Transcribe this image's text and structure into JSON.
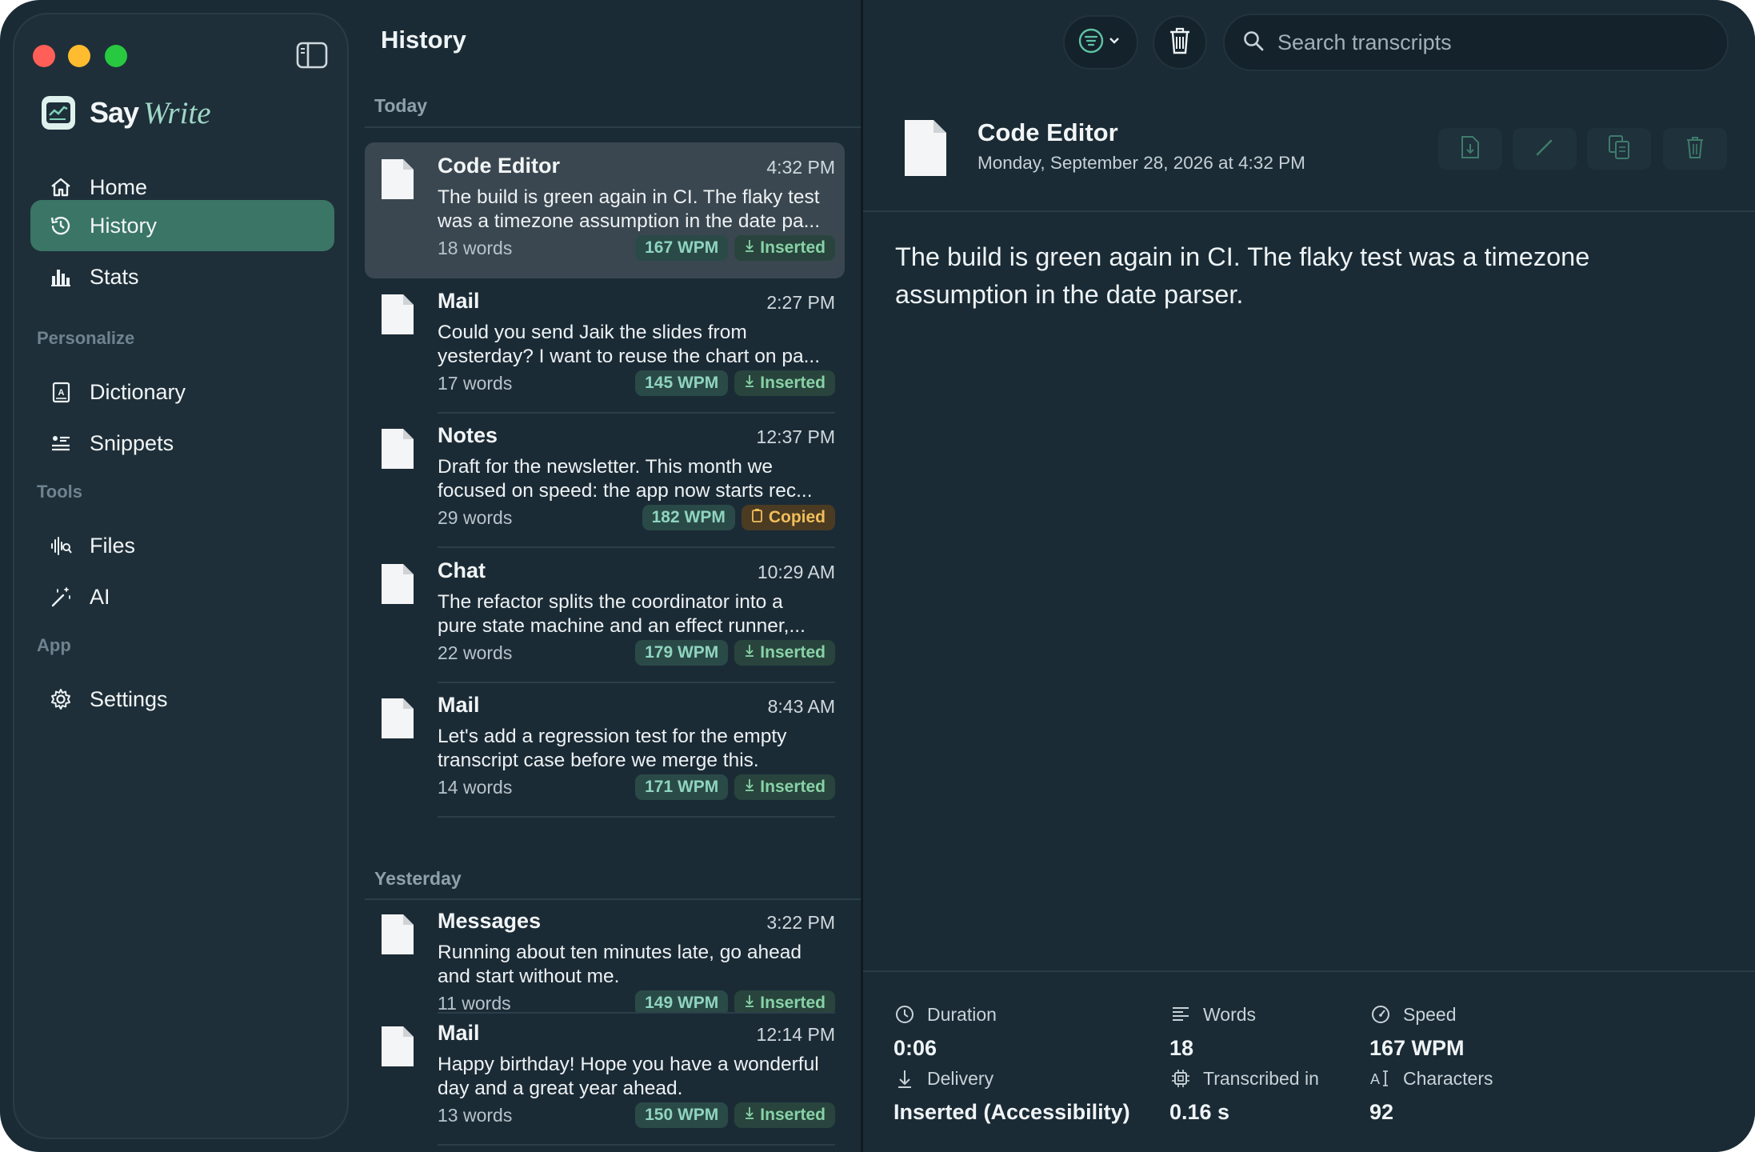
{
  "app": {
    "brand_say": "Say",
    "brand_write": "Write",
    "colors": {
      "accent": "#3a7565",
      "background": "#1b2b36",
      "copied": "#f1be5b",
      "inserted": "#88d2a6"
    }
  },
  "sidebar": {
    "main_items": [
      {
        "label": "Home",
        "icon": "home-icon"
      },
      {
        "label": "History",
        "icon": "history-icon",
        "active": true
      },
      {
        "label": "Stats",
        "icon": "stats-icon"
      }
    ],
    "sections": [
      {
        "title": "Personalize",
        "items": [
          {
            "label": "Dictionary",
            "icon": "dictionary-icon"
          },
          {
            "label": "Snippets",
            "icon": "snippets-icon"
          }
        ]
      },
      {
        "title": "Tools",
        "items": [
          {
            "label": "Files",
            "icon": "waveform-icon"
          },
          {
            "label": "AI",
            "icon": "magic-wand-icon"
          }
        ]
      },
      {
        "title": "App",
        "items": [
          {
            "label": "Settings",
            "icon": "gear-icon"
          }
        ]
      }
    ]
  },
  "history": {
    "title": "History",
    "groups": [
      {
        "label": "Today",
        "items": [
          {
            "app": "Code Editor",
            "time": "4:32 PM",
            "line1": "The build is green again in CI. The flaky test",
            "line2": "was a timezone assumption in the date pa...",
            "words": "18 words",
            "wpm": "167 WPM",
            "status": "Inserted",
            "status_kind": "inserted",
            "selected": true
          },
          {
            "app": "Mail",
            "time": "2:27 PM",
            "line1": "Could you send Jaik the slides from",
            "line2": "yesterday? I want to reuse the chart on pa...",
            "words": "17 words",
            "wpm": "145 WPM",
            "status": "Inserted",
            "status_kind": "inserted"
          },
          {
            "app": "Notes",
            "time": "12:37 PM",
            "line1": "Draft for the newsletter. This month we",
            "line2": "focused on speed: the app now starts rec...",
            "words": "29 words",
            "wpm": "182 WPM",
            "status": "Copied",
            "status_kind": "copied"
          },
          {
            "app": "Chat",
            "time": "10:29 AM",
            "line1": "The refactor splits the coordinator into a",
            "line2": "pure state machine and an effect runner,...",
            "words": "22 words",
            "wpm": "179 WPM",
            "status": "Inserted",
            "status_kind": "inserted"
          },
          {
            "app": "Mail",
            "time": "8:43 AM",
            "line1": "Let's add a regression test for the empty",
            "line2": "transcript case before we merge this.",
            "words": "14 words",
            "wpm": "171 WPM",
            "status": "Inserted",
            "status_kind": "inserted"
          }
        ]
      },
      {
        "label": "Yesterday",
        "items": [
          {
            "app": "Messages",
            "time": "3:22 PM",
            "line1": "Running about ten minutes late, go ahead",
            "line2": "and start without me.",
            "words": "11 words",
            "wpm": "149 WPM",
            "status": "Inserted",
            "status_kind": "inserted"
          },
          {
            "app": "Mail",
            "time": "12:14 PM",
            "line1": "Happy birthday! Hope you have a wonderful",
            "line2": "day and a great year ahead.",
            "words": "13 words",
            "wpm": "150 WPM",
            "status": "Inserted",
            "status_kind": "inserted"
          }
        ]
      }
    ]
  },
  "toolbar": {
    "search_placeholder": "Search transcripts",
    "filter_icon": "filter-icon",
    "delete_all_icon": "trash-icon"
  },
  "detail": {
    "app": "Code Editor",
    "date": "Monday, September 28, 2026 at 4:32 PM",
    "actions": [
      "export-icon",
      "edit-icon",
      "copy-icon",
      "delete-icon"
    ],
    "transcript_line1": "The build is green again in CI. The flaky test was a timezone",
    "transcript_line2": "assumption in the date parser.",
    "stats": [
      {
        "label": "Duration",
        "value": "0:06",
        "icon": "clock-icon"
      },
      {
        "label": "Words",
        "value": "18",
        "icon": "text-lines-icon"
      },
      {
        "label": "Speed",
        "value": "167 WPM",
        "icon": "speedometer-icon"
      },
      {
        "label": "Delivery",
        "value": "Inserted (Accessibility)",
        "icon": "download-arrow-icon"
      },
      {
        "label": "Transcribed in",
        "value": "0.16 s",
        "icon": "chip-icon"
      },
      {
        "label": "Characters",
        "value": "92",
        "icon": "text-cursor-icon"
      }
    ]
  }
}
